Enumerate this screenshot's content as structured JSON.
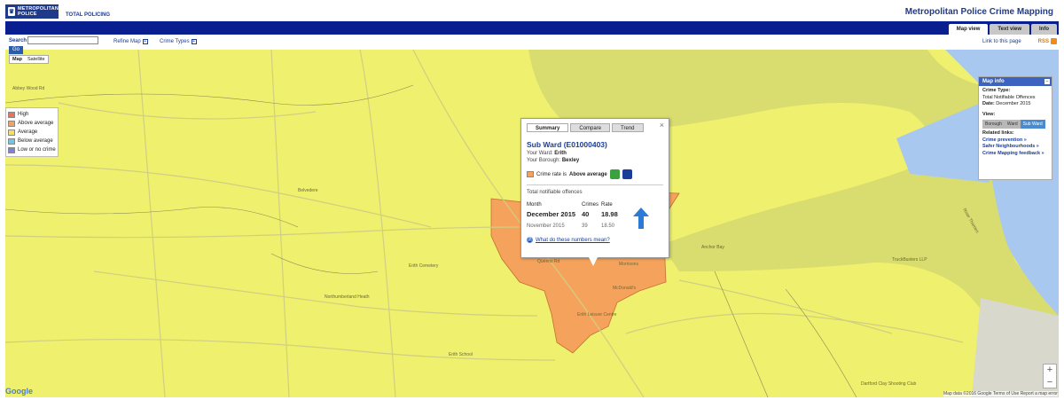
{
  "header": {
    "logo_line1": "METROPOLITAN",
    "logo_line2": "POLICE",
    "tagline": "TOTAL POLICING",
    "app_title": "Metropolitan Police Crime Mapping",
    "tabs": [
      {
        "label": "Map view",
        "active": true
      },
      {
        "label": "Text view",
        "active": false
      },
      {
        "label": "Info",
        "active": false
      }
    ]
  },
  "toolbar": {
    "search_label": "Search",
    "search_value": "",
    "go_label": "Go",
    "refine_map": "Refine Map",
    "crime_types": "Crime Types",
    "link_to_page": "Link to this page",
    "rss": "RSS"
  },
  "maptype": {
    "map": "Map",
    "satellite": "Satellite"
  },
  "legend": [
    {
      "label": "High",
      "color": "#e8735a"
    },
    {
      "label": "Above average",
      "color": "#f5a35c"
    },
    {
      "label": "Average",
      "color": "#f5e15a"
    },
    {
      "label": "Below average",
      "color": "#6fc7e8"
    },
    {
      "label": "Low or no crime",
      "color": "#7f7fd6"
    }
  ],
  "popup": {
    "tabs": [
      "Summary",
      "Compare",
      "Trend"
    ],
    "title": "Sub Ward (E01000403)",
    "ward_label": "Your Ward:",
    "ward": "Erith",
    "borough_label": "Your Borough:",
    "borough": "Bexley",
    "rate_prefix": "Crime rate is",
    "rate_value": "Above average",
    "total_label": "Total notifiable offences",
    "col_month": "Month",
    "col_crimes": "Crimes",
    "col_rate": "Rate",
    "rows": [
      {
        "month": "December 2015",
        "crimes": "40",
        "rate": "18.98"
      },
      {
        "month": "November 2015",
        "crimes": "39",
        "rate": "18.50"
      }
    ],
    "help": "What do these numbers mean?",
    "close": "×"
  },
  "info_panel": {
    "title": "Map info",
    "crime_type_label": "Crime Type:",
    "crime_type": "Total Notifiable Offences",
    "date_label": "Date:",
    "date": "December 2015",
    "view_label": "View:",
    "view_buttons": [
      "Borough",
      "Ward",
      "Sub Ward"
    ],
    "related_label": "Related links:",
    "links": [
      "Crime prevention »",
      "Safer Neighbourhoods »",
      "Crime Mapping feedback »"
    ]
  },
  "map": {
    "labels": [
      "Abbey Wood Rd",
      "Belvedere",
      "Erith Cemetery",
      "Erith Leisure Centre",
      "Anchor Bay",
      "River Thames",
      "Erith School",
      "Morrisons",
      "Northumberland Heath",
      "TruckBusters LLP",
      "Dartford Clay Shooting Club",
      "Queens Rd",
      "McDonald's"
    ],
    "google": "Google",
    "attribution": "Map data ©2016 Google   Terms of Use   Report a map error",
    "zoom_in": "+",
    "zoom_out": "−"
  }
}
